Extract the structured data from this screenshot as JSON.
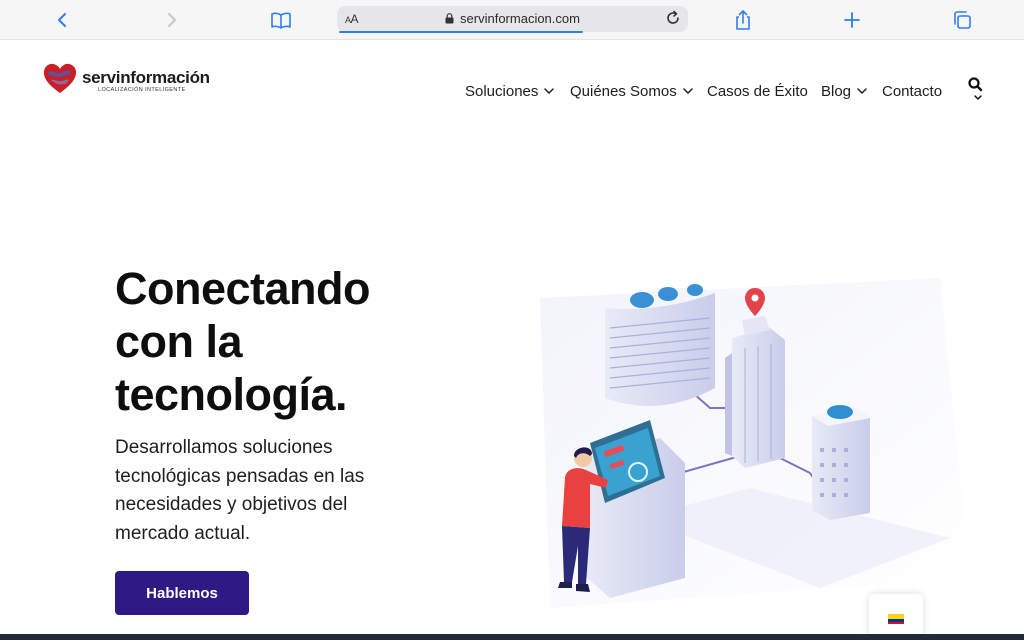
{
  "browser": {
    "address_prefix": "AA",
    "url": "servinformacion.com",
    "accent": "#2f7cf6"
  },
  "site": {
    "brand": "servinformación",
    "tagline": "LOCALIZACIÓN INTELIGENTE",
    "nav": [
      {
        "label": "Soluciones",
        "dropdown": true
      },
      {
        "label": "Quiénes Somos",
        "dropdown": true
      },
      {
        "label": "Casos de Éxito",
        "dropdown": false
      },
      {
        "label": "Blog",
        "dropdown": true
      },
      {
        "label": "Contacto",
        "dropdown": false
      }
    ]
  },
  "hero": {
    "title_lines": [
      "Conectando",
      "con la",
      "tecnología."
    ],
    "description_lines": [
      "Desarrollamos soluciones",
      "tecnológicas pensadas en las",
      "necesidades y objetivos del",
      "mercado actual."
    ],
    "cta_label": "Hablemos",
    "cta_color": "#2d1a85"
  },
  "language": {
    "flag_colors": [
      "#fcd116",
      "#003893",
      "#ce1126"
    ]
  }
}
